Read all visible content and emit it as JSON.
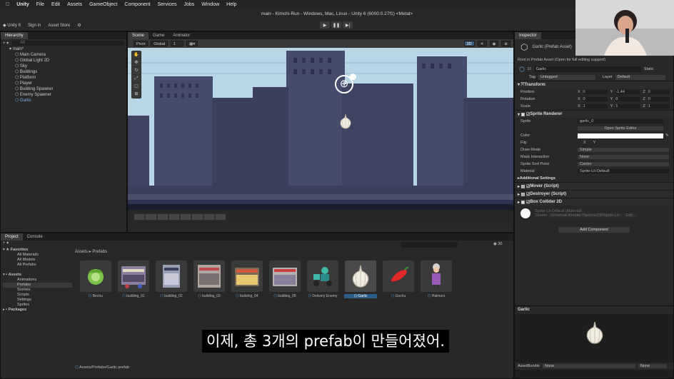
{
  "mac_menu": {
    "apple_icon": "apple-icon",
    "items": [
      "Unity",
      "File",
      "Edit",
      "Assets",
      "GameObject",
      "Component",
      "Services",
      "Jobs",
      "Window",
      "Help"
    ]
  },
  "window_title": "main - Kimchi-Run - Windows, Mac, Linux - Unity 6 (6000.0.27f1) <Metal>",
  "toolbar": {
    "account": "Unity 6",
    "sign_in": "Sign in",
    "asset_store": "Asset Store"
  },
  "hierarchy": {
    "tab": "Hierarchy",
    "search_placeholder": "All",
    "scene": "main*",
    "items": [
      "Main Camera",
      "Global Light 2D",
      "Sky",
      "Buildings",
      "Platform",
      "Player",
      "Building Spawner",
      "Enemy Spawner",
      "Garlic"
    ]
  },
  "scene_tabs": [
    "Scene",
    "Game",
    "Animator"
  ],
  "scene_toolbar": {
    "pivot": "Pivot",
    "global": "Global",
    "snap": "1",
    "mode_2d": "2D"
  },
  "project": {
    "tabs": [
      "Project",
      "Console"
    ],
    "favorites_label": "Favorites",
    "favorites": [
      "All Materials",
      "All Models",
      "All Prefabs"
    ],
    "assets_label": "Assets",
    "assets_folders": [
      "Animations",
      "Prefabs",
      "Scenes",
      "Scripts",
      "Settings",
      "Sprites"
    ],
    "packages_label": "Packages",
    "breadcrumb_root": "Assets",
    "breadcrumb_current": "Prefabs",
    "hidden_count": "30",
    "prefabs": [
      "Bechu",
      "building_01",
      "building_02",
      "building_03",
      "building_04",
      "building_05",
      "Delivery Enemy",
      "Garlic",
      "Gochu",
      "Halmoni"
    ],
    "selected_prefab": "Garlic",
    "status_path": "Assets/Prefabs/Garlic.prefab"
  },
  "inspector": {
    "tab": "Inspector",
    "title": "Garlic (Prefab Asset)",
    "root_note": "Root in Prefab Asset (Open for full editing support)",
    "name": "Garlic",
    "static_label": "Static",
    "tag_label": "Tag",
    "tag_value": "Untagged",
    "layer_label": "Layer",
    "layer_value": "Default",
    "transform": {
      "title": "Transform",
      "position_label": "Position",
      "position": [
        "0",
        "-1.44",
        "0"
      ],
      "rotation_label": "Rotation",
      "rotation": [
        "0",
        "0",
        "0"
      ],
      "scale_label": "Scale",
      "scale": [
        "1",
        "1",
        "1"
      ]
    },
    "sprite_renderer": {
      "title": "Sprite Renderer",
      "sprite_label": "Sprite",
      "sprite_value": "garlic_0",
      "open_editor": "Open Sprite Editor",
      "color_label": "Color",
      "flip_label": "Flip",
      "flip_x": "X",
      "flip_y": "Y",
      "draw_mode_label": "Draw Mode",
      "draw_mode_value": "Simple",
      "mask_label": "Mask Interaction",
      "mask_value": "None",
      "sort_point_label": "Sprite Sort Point",
      "sort_point_value": "Center",
      "material_label": "Material",
      "material_value": "Sprite-Lit-Default",
      "additional": "Additional Settings"
    },
    "components": [
      "Mover (Script)",
      "Destroyer (Script)",
      "Box Collider 2D"
    ],
    "material_preview": "Sprite-Lit-Default (Material)",
    "shader_label": "Shader",
    "shader_value": "Universal Render Pipeline/2D/Sprite-Lit-",
    "edit_button": "Edit...",
    "add_component": "Add Component",
    "preview_title": "Garlic",
    "assetbundle_label": "AssetBundle",
    "assetbundle_value": "None",
    "assetbundle_variant": "None"
  },
  "subtitle": "이제, 총 3개의 prefab이 만들어졌어.",
  "colors": {
    "sky": "#b9d6e6",
    "building_dark": "#3a3f5c",
    "building_mid": "#454b6b",
    "selection": "#2c5d87",
    "panel": "#282828"
  }
}
